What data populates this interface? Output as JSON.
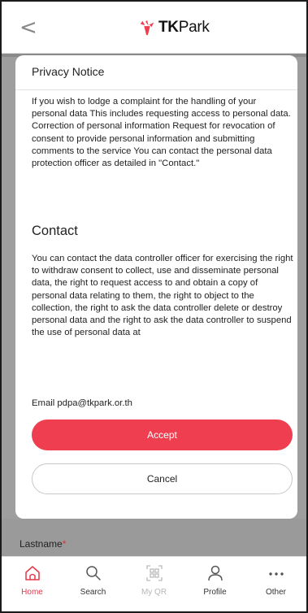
{
  "header": {
    "back_label": "<",
    "logo": {
      "prefix": "TK",
      "suffix": "Park",
      "brand_color": "#ef3e4f"
    }
  },
  "modal": {
    "title": "Privacy Notice",
    "notice_text": "If you wish to lodge a complaint for the handling of your personal data This includes requesting access to personal data. Correction of personal information Request for revocation of consent to provide personal information and submitting comments to the service You can contact the personal data protection officer as detailed in \"Contact.\"",
    "contact_heading": "Contact",
    "contact_text": "You can contact the data controller officer for exercising the right to withdraw consent to collect, use and disseminate personal data, the right to request access to and obtain a copy of personal data relating to them, the right to object to the collection, the right to ask the data controller delete or destroy personal data and the right to ask the data controller to suspend the use of personal data at",
    "email_text": "Email pdpa@tkpark.or.th",
    "accept_label": "Accept",
    "cancel_label": "Cancel",
    "accent_color": "#ef3e4f"
  },
  "background_form": {
    "field_label": "Lastname",
    "required_mark": "*"
  },
  "tabbar": {
    "items": [
      {
        "label": "Home",
        "icon": "home-icon",
        "state": "active"
      },
      {
        "label": "Search",
        "icon": "search-icon",
        "state": "normal"
      },
      {
        "label": "My QR",
        "icon": "qr-code-icon",
        "state": "disabled"
      },
      {
        "label": "Profile",
        "icon": "profile-icon",
        "state": "normal"
      },
      {
        "label": "Other",
        "icon": "more-icon",
        "state": "normal"
      }
    ]
  }
}
